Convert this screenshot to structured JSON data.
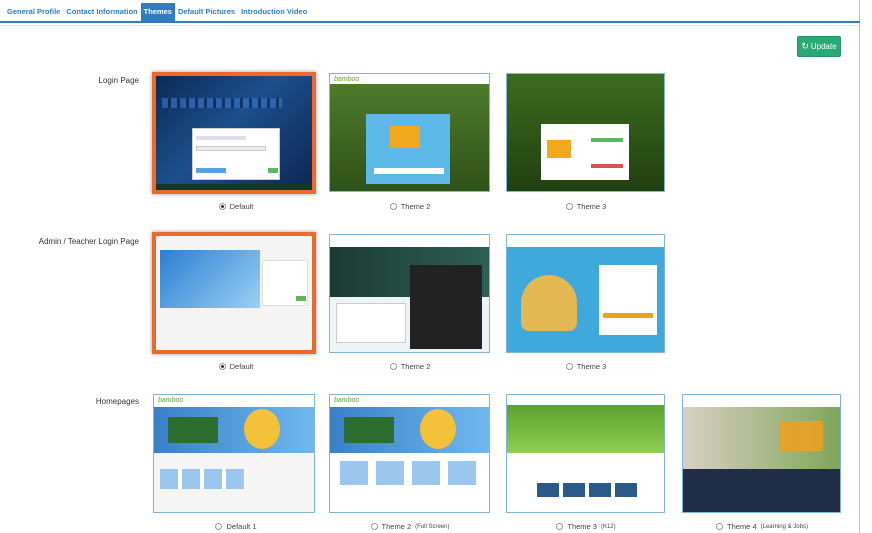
{
  "tabs": [
    {
      "label": "General Profile",
      "active": false
    },
    {
      "label": "Contact Information",
      "active": false
    },
    {
      "label": "Themes",
      "active": true
    },
    {
      "label": "Default Pictures",
      "active": false
    },
    {
      "label": "Introduction Video",
      "active": false
    }
  ],
  "update_button": {
    "label": "Update",
    "icon": "refresh-icon",
    "color": "#2aa876"
  },
  "accent_color": "#2f7dc0",
  "selected_border_color": "#e86a2e",
  "brand_text": "bamboo",
  "sections": {
    "login": {
      "label": "Login Page",
      "options": [
        {
          "name": "Default",
          "selected": true
        },
        {
          "name": "Theme 2",
          "selected": false
        },
        {
          "name": "Theme 3",
          "selected": false
        }
      ]
    },
    "admin": {
      "label": "Admin / Teacher Login Page",
      "options": [
        {
          "name": "Default",
          "selected": true
        },
        {
          "name": "Theme 2",
          "selected": false
        },
        {
          "name": "Theme 3",
          "selected": false
        }
      ]
    },
    "home": {
      "label": "Homepages",
      "options": [
        {
          "name": "Default 1",
          "note": "",
          "selected": false
        },
        {
          "name": "Theme 2",
          "note": "(Full Screen)",
          "selected": false
        },
        {
          "name": "Theme 3",
          "note": "(K12)",
          "selected": false
        },
        {
          "name": "Theme 4",
          "note": "(Learning & Jobs)",
          "selected": false
        }
      ]
    }
  }
}
